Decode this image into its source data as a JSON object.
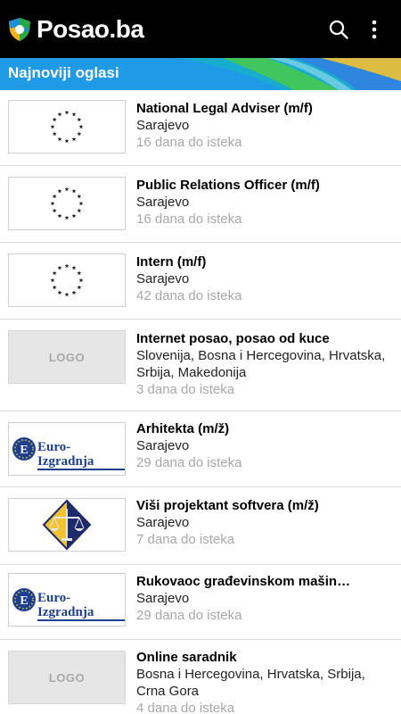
{
  "app": {
    "name": "Posao.ba",
    "colors": {
      "appbar": "#000000",
      "header": "#1e9ae6",
      "deadline_text": "#a8a8a8"
    },
    "icons": {
      "logo": "posao-shield-logo-icon",
      "search": "search-icon",
      "menu": "overflow-menu-icon"
    }
  },
  "section": {
    "title": "Najnoviji oglasi"
  },
  "jobs": [
    {
      "title": "National Legal Adviser (m/f)",
      "location": "Sarajevo",
      "deadline": "16 dana do isteka",
      "logo": "eu-flag"
    },
    {
      "title": "Public Relations Officer (m/f)",
      "location": "Sarajevo",
      "deadline": "16 dana do isteka",
      "logo": "eu-flag"
    },
    {
      "title": "Intern (m/f)",
      "location": "Sarajevo",
      "deadline": "42 dana do isteka",
      "logo": "eu-flag"
    },
    {
      "title": "Internet posao, posao od kuce",
      "location": "Slovenija, Bosna i Hercegovina, Hrvatska, Srbija, Makedonija",
      "deadline": "3 dana do isteka",
      "logo": "placeholder",
      "logo_text": "LOGO"
    },
    {
      "title": "Arhitekta (m/ž)",
      "location": "Sarajevo",
      "deadline": "29 dana do isteka",
      "logo": "euro-izgradnja",
      "logo_text": "Euro-Izgradnja"
    },
    {
      "title": "Viši projektant softvera (m/ž)",
      "location": "Sarajevo",
      "deadline": "7 dana do isteka",
      "logo": "justice-scales"
    },
    {
      "title": "Rukovaoc građevinskom mašin…",
      "location": "Sarajevo",
      "deadline": "29 dana do isteka",
      "logo": "euro-izgradnja",
      "logo_text": "Euro-Izgradnja"
    },
    {
      "title": "Online saradnik",
      "location": "Bosna i Hercegovina, Hrvatska, Srbija, Crna Gora",
      "deadline": "4 dana do isteka",
      "logo": "placeholder",
      "logo_text": "LOGO"
    }
  ]
}
